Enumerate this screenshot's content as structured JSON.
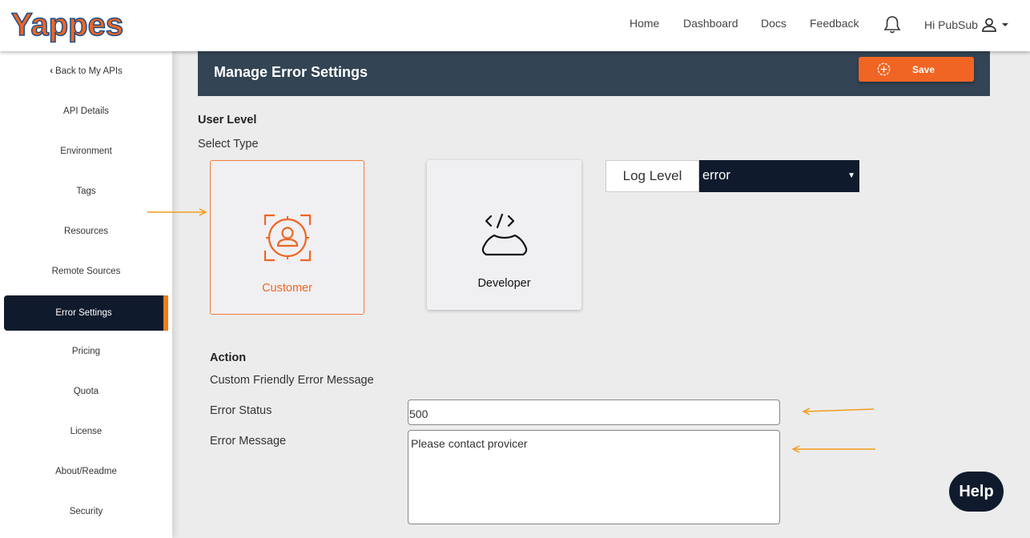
{
  "app": {
    "logo_text": "Yappes"
  },
  "nav": {
    "home": "Home",
    "dashboard": "Dashboard",
    "docs": "Docs",
    "feedback": "Feedback",
    "user_greeting": "Hi PubSub"
  },
  "sidebar": {
    "back": "Back to My APIs",
    "items": [
      {
        "label": "API Details"
      },
      {
        "label": "Environment"
      },
      {
        "label": "Tags"
      },
      {
        "label": "Resources"
      },
      {
        "label": "Remote Sources"
      },
      {
        "label": "Error Settings",
        "active": true
      },
      {
        "label": "Pricing"
      },
      {
        "label": "Quota"
      },
      {
        "label": "License"
      },
      {
        "label": "About/Readme"
      },
      {
        "label": "Security"
      }
    ]
  },
  "header": {
    "title": "Manage Error Settings",
    "save_label": "Save"
  },
  "user_level": {
    "heading": "User Level",
    "select_type": "Select Type",
    "customer_label": "Customer",
    "developer_label": "Developer",
    "log_level_label": "Log Level",
    "log_level_value": "error"
  },
  "action": {
    "heading": "Action",
    "subheading": "Custom Friendly Error Message",
    "error_status_label": "Error Status",
    "error_status_value": "500",
    "error_message_label": "Error Message",
    "error_message_value": "Please contact provicer"
  },
  "help_label": "Help",
  "colors": {
    "accent": "#f06523",
    "navy": "#0f1b2d",
    "header": "#334454",
    "annotation_arrow": "#f29b1d"
  }
}
